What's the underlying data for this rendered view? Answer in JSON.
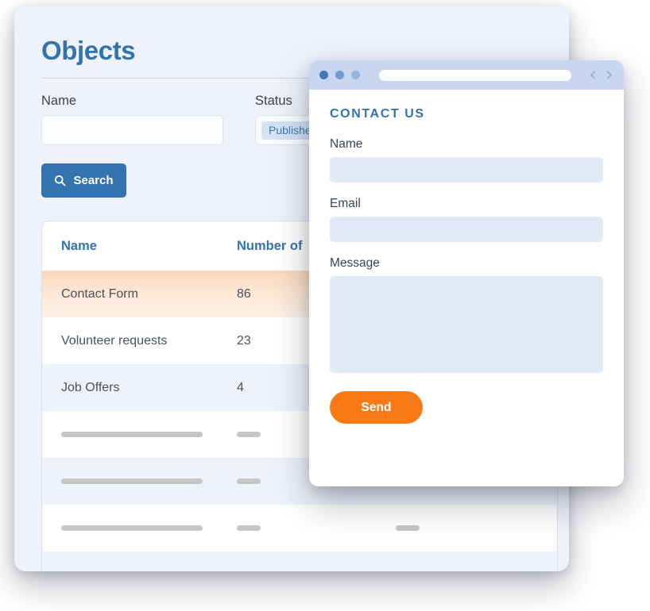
{
  "objects_window": {
    "title": "Objects",
    "filters": {
      "name": {
        "label": "Name",
        "value": "",
        "placeholder": ""
      },
      "status": {
        "label": "Status",
        "selected_chip": "Published",
        "chip_remove_glyph": "✕"
      }
    },
    "search_button": {
      "label": "Search",
      "icon": "search-icon"
    },
    "table": {
      "columns": [
        "Name",
        "Number of",
        ""
      ],
      "rows": [
        {
          "name": "Contact Form",
          "number": "86",
          "highlighted": true
        },
        {
          "name": "Volunteer requests",
          "number": "23",
          "highlighted": false
        },
        {
          "name": "Job Offers",
          "number": "4",
          "highlighted": false
        }
      ],
      "skeleton_rows": 3
    }
  },
  "browser_window": {
    "chrome": {
      "dots": [
        "window-dot-1",
        "window-dot-2",
        "window-dot-3"
      ],
      "url_value": "",
      "nav_back_icon": "chevron-left-icon",
      "nav_forward_icon": "chevron-right-icon"
    },
    "form": {
      "heading": "CONTACT US",
      "fields": [
        {
          "label": "Name",
          "value": "",
          "type": "text"
        },
        {
          "label": "Email",
          "value": "",
          "type": "text"
        },
        {
          "label": "Message",
          "value": "",
          "type": "textarea"
        }
      ],
      "submit_label": "Send"
    }
  },
  "colors": {
    "brand_blue": "#3373b0",
    "panel_bg": "#eef2fb",
    "chrome_bg": "#c9d6ef",
    "chip_bg": "#d6e2f5",
    "field_bg": "#e3eaf7",
    "accent_orange": "#f97a15",
    "row_highlight": "#fad9bd",
    "skeleton_gray": "#c6c6c6"
  }
}
